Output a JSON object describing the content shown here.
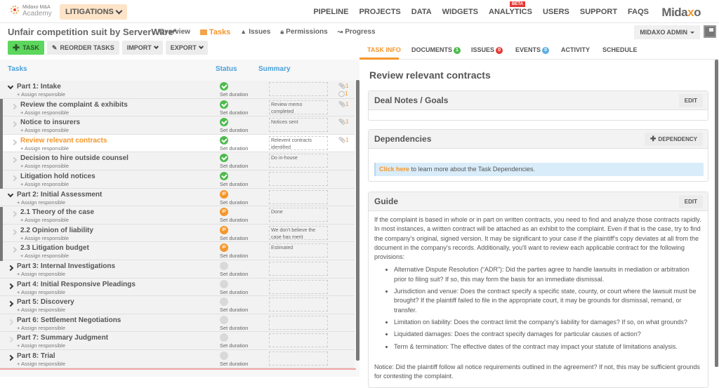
{
  "header": {
    "logo_line1": "Midaxo M&A",
    "logo_line2": "Academy",
    "context_button": "LITIGATIONS",
    "nav": [
      "PIPELINE",
      "PROJECTS",
      "DATA",
      "WIDGETS",
      "ANALYTICS",
      "USERS",
      "SUPPORT",
      "FAQS"
    ],
    "beta_badge": "BETA",
    "brand_pre": "Mida",
    "brand_x": "x",
    "brand_post": "o"
  },
  "project": {
    "title": "Unfair competition suit by ServerWare*",
    "subnav": [
      {
        "label": "Overview",
        "icon": "home-icon"
      },
      {
        "label": "Tasks",
        "icon": "tasks-icon",
        "active": true
      },
      {
        "label": "Issues",
        "icon": "warning-icon"
      },
      {
        "label": "Permissions",
        "icon": "lock-icon"
      },
      {
        "label": "Progress",
        "icon": "chart-icon"
      }
    ],
    "user_menu": "MIDAXO ADMIN"
  },
  "toolbar": {
    "add_task": "TASK",
    "reorder": "REORDER TASKS",
    "import": "IMPORT",
    "export": "EXPORT"
  },
  "columns": {
    "tasks": "Tasks",
    "status": "Status",
    "summary": "Summary"
  },
  "tasks": [
    {
      "type": "part",
      "name": "Part 1: Intake",
      "assign": "+ Assign responsible",
      "status": "done",
      "duration": "Set duration",
      "summary": "",
      "attachments": "1",
      "comments": "1",
      "expander": "down"
    },
    {
      "type": "child",
      "name": "Review the complaint & exhibits",
      "assign": "+ Assign responsible",
      "status": "done",
      "duration": "Set duration",
      "summary": "Review memo completed",
      "attachments": "1"
    },
    {
      "type": "child",
      "name": "Notice to insurers",
      "assign": "+ Assign responsible",
      "status": "done",
      "duration": "Set duration",
      "summary": "Notices sent",
      "attachments": "1"
    },
    {
      "type": "child",
      "name": "Review relevant contracts",
      "assign": "+ Assign responsible",
      "status": "done",
      "duration": "Set duration",
      "summary": "Relevent contracts identified",
      "attachments": "1",
      "selected": true
    },
    {
      "type": "child",
      "name": "Decision to hire outside counsel",
      "assign": "+ Assign responsible",
      "status": "done",
      "duration": "Set duration",
      "summary": "Do in-house"
    },
    {
      "type": "child",
      "name": "Litigation hold notices",
      "assign": "+ Assign responsible",
      "status": "done",
      "duration": "Set duration",
      "summary": ""
    },
    {
      "type": "part",
      "name": "Part 2: Initial Assessment",
      "assign": "+ Assign responsible",
      "status": "ip",
      "duration": "Set duration",
      "summary": "",
      "expander": "down"
    },
    {
      "type": "child",
      "name": "2.1 Theory of the case",
      "assign": "+ Assign responsible",
      "status": "ip",
      "duration": "Set duration",
      "summary": "Done"
    },
    {
      "type": "child",
      "name": "2.2 Opinion of liability",
      "assign": "+ Assign responsible",
      "status": "ip",
      "duration": "Set duration",
      "summary": "We don't believe the case has merit"
    },
    {
      "type": "child",
      "name": "2.3 Litigation budget",
      "assign": "+ Assign responsible",
      "status": "ip",
      "duration": "Set duration",
      "summary": "Estimated"
    },
    {
      "type": "part",
      "name": "Part 3: Internal Investigations",
      "assign": "+ Assign responsible",
      "status": "none",
      "duration": "Set duration",
      "summary": "",
      "expander": "right"
    },
    {
      "type": "part",
      "name": "Part 4: Initial Responsive Pleadings",
      "assign": "+ Assign responsible",
      "status": "none",
      "duration": "Set duration",
      "summary": "",
      "expander": "right"
    },
    {
      "type": "part",
      "name": "Part 5: Discovery",
      "assign": "+ Assign responsible",
      "status": "none",
      "duration": "Set duration",
      "summary": "",
      "expander": "right"
    },
    {
      "type": "part",
      "name": "Part 6: Settlement Negotiations",
      "assign": "+ Assign responsible",
      "status": "none",
      "duration": "Set duration",
      "summary": "",
      "expander": "faint"
    },
    {
      "type": "part",
      "name": "Part 7: Summary Judgment",
      "assign": "+ Assign responsible",
      "status": "none",
      "duration": "Set duration",
      "summary": "",
      "expander": "faint"
    },
    {
      "type": "part",
      "name": "Part 8: Trial",
      "assign": "+ Assign responsible",
      "status": "none",
      "duration": "Set duration",
      "summary": "",
      "expander": "right"
    }
  ],
  "status_ip_label": "IP",
  "detail": {
    "tabs": [
      {
        "label": "TASK INFO",
        "active": true
      },
      {
        "label": "DOCUMENTS",
        "badge": "1",
        "badge_color": "#4cbb4c"
      },
      {
        "label": "ISSUES",
        "badge": "0",
        "badge_color": "#e53935"
      },
      {
        "label": "EVENTS",
        "badge": "0",
        "badge_color": "#5aaee6"
      },
      {
        "label": "ACTIVITY"
      },
      {
        "label": "SCHEDULE"
      }
    ],
    "title": "Review relevant contracts",
    "deal_notes": {
      "title": "Deal Notes / Goals",
      "button": "EDIT"
    },
    "dependencies": {
      "title": "Dependencies",
      "button": "DEPENDENCY",
      "info_link": "Click here",
      "info_text": " to learn more about the Task Dependencies."
    },
    "guide": {
      "title": "Guide",
      "button": "EDIT",
      "intro": "If the complaint is based in whole or in part on written contracts, you need to find and analyze those contracts rapidly. In most instances, a written contract will be attached as an exhibit to the complaint. Even if that is the case, try to find the company's original, signed version. It may be significant to your case if the plaintiff's copy deviates at all from the document in the company's records. Additionally, you'll want to review each applicable contract for the following provisions:",
      "bullets": [
        "Alternative Dispute Resolution (“ADR”): Did the parties agree to handle lawsuits in mediation or arbitration prior to filing suit? If so, this may form the basis for an immediate dismissal.",
        "Jurisdiction and venue: Does the contract specify a specific state, county, or court where the lawsuit must be brought? If the plaintiff failed to file in the appropriate court, it may be grounds for dismissal, remand, or transfer.",
        "Limitation on liability: Does the contract limit the company's liability for damages? If so, on what grounds?",
        "Liquidated damages: Does the contract specify damages for particular causes of action?",
        "Term & termination: The effective dates of the contract may impact your statute of limitations analysis."
      ],
      "notice": "Notice: Did the plaintiff follow all notice requirements outlined in the agreement? If not, this may be sufficient grounds for contesting the complaint."
    }
  }
}
